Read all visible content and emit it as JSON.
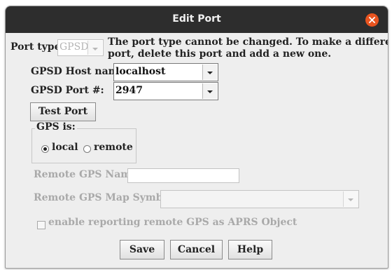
{
  "window": {
    "title": "Edit Port"
  },
  "port_type": {
    "label": "Port type",
    "value": "GPSD",
    "note_line1": "The port type cannot be changed. To make a different type",
    "note_line2": "port, delete this port and add a new one."
  },
  "host": {
    "label": "GPSD Host name:",
    "value": "localhost"
  },
  "port": {
    "label": "GPSD Port #:",
    "value": "2947"
  },
  "test_button": "Test Port",
  "gps_is": {
    "label": "GPS is:",
    "local_label": "local",
    "remote_label": "remote",
    "selected": "local"
  },
  "remote_name": {
    "label": "Remote GPS Name:",
    "value": ""
  },
  "remote_symbol": {
    "label": "Remote GPS Map Symbol:",
    "value": ""
  },
  "aprs_checkbox": {
    "label": "enable reporting remote GPS as APRS Object",
    "checked": false
  },
  "buttons": {
    "save": "Save",
    "cancel": "Cancel",
    "help": "Help"
  },
  "colors": {
    "titlebar": "#2d2d2d",
    "close": "#e9541f",
    "dialog_bg": "#eeeeee",
    "disabled_text": "#a9a9a9"
  }
}
